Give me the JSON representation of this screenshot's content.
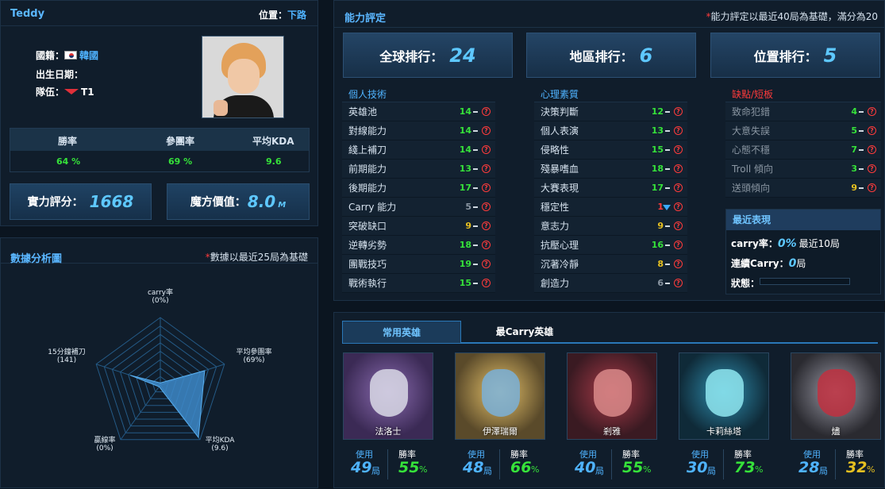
{
  "profile": {
    "name": "Teddy",
    "position_label": "位置：",
    "position": "下路",
    "nationality_label": "國籍：",
    "nationality": "韓國",
    "birth_label": "出生日期：",
    "team_label": "隊伍：",
    "team": "T1",
    "stats": {
      "headers": [
        "勝率",
        "參團率",
        "平均KDA"
      ],
      "values": [
        "64 %",
        "69 %",
        "9.6"
      ]
    },
    "strength_label": "實力評分：",
    "strength": "1668",
    "value_label": "魔方價值：",
    "value": "8.0",
    "value_unit": "M"
  },
  "radar": {
    "title": "數據分析圖",
    "note": "數據以最近25局為基礎",
    "note_star": "*",
    "labels": [
      {
        "name": "carry率",
        "val": "(0%)"
      },
      {
        "name": "平均參團率",
        "val": "(69%)"
      },
      {
        "name": "平均KDA",
        "val": "(9.6)"
      },
      {
        "name": "贏線率",
        "val": "(0%)"
      },
      {
        "name": "15分鐘補刀",
        "val": "(141)"
      }
    ],
    "values": [
      0,
      0.69,
      0.96,
      0,
      0.47
    ]
  },
  "ability": {
    "title": "能力評定",
    "note": "能力評定以最近40局為基礎，滿分為20",
    "note_star": "*",
    "ranks": [
      {
        "label": "全球排行：",
        "num": "24"
      },
      {
        "label": "地區排行：",
        "num": "6"
      },
      {
        "label": "位置排行：",
        "num": "5"
      }
    ],
    "col1": {
      "title": "個人技術",
      "rows": [
        [
          "英雄池",
          "14"
        ],
        [
          "對線能力",
          "14"
        ],
        [
          "綫上補刀",
          "14"
        ],
        [
          "前期能力",
          "13"
        ],
        [
          "後期能力",
          "17"
        ],
        [
          "Carry 能力",
          "5"
        ],
        [
          "突破缺口",
          "9"
        ],
        [
          "逆轉劣勢",
          "18"
        ],
        [
          "團戰技巧",
          "19"
        ],
        [
          "戰術執行",
          "15"
        ]
      ]
    },
    "col2": {
      "title": "心理素質",
      "rows": [
        [
          "決策判斷",
          "12"
        ],
        [
          "個人表演",
          "13"
        ],
        [
          "侵略性",
          "15"
        ],
        [
          "殘暴嗜血",
          "18"
        ],
        [
          "大賽表現",
          "17"
        ],
        [
          "穩定性",
          "1"
        ],
        [
          "意志力",
          "9"
        ],
        [
          "抗壓心理",
          "16"
        ],
        [
          "沉著冷靜",
          "8"
        ],
        [
          "創造力",
          "6"
        ]
      ]
    },
    "col3": {
      "title": "缺點/短板",
      "rows": [
        [
          "致命犯錯",
          "4"
        ],
        [
          "大意失誤",
          "5"
        ],
        [
          "心態不穩",
          "7"
        ],
        [
          "Troll 傾向",
          "3"
        ],
        [
          "送頭傾向",
          "9"
        ]
      ]
    },
    "recent": {
      "title": "最近表現",
      "carry_label": "carry率：",
      "carry": "0%",
      "carry_suffix": "最近10局",
      "streak_label": "連續Carry：",
      "streak": "0",
      "streak_unit": "局",
      "status_label": "狀態："
    }
  },
  "heroes": {
    "tabs": [
      "常用英雄",
      "最Carry英雄"
    ],
    "use_label": "使用",
    "win_label": "勝率",
    "games_unit": "局",
    "pct_unit": "%",
    "list": [
      {
        "name": "法洛士",
        "games": "49",
        "win": "55",
        "color": "#36e23a"
      },
      {
        "name": "伊澤瑞爾",
        "games": "48",
        "win": "66",
        "color": "#36e23a"
      },
      {
        "name": "剎雅",
        "games": "40",
        "win": "55",
        "color": "#36e23a"
      },
      {
        "name": "卡莉絲塔",
        "games": "30",
        "win": "73",
        "color": "#36e23a"
      },
      {
        "name": "燼",
        "games": "28",
        "win": "32",
        "color": "#e6c020"
      }
    ]
  }
}
